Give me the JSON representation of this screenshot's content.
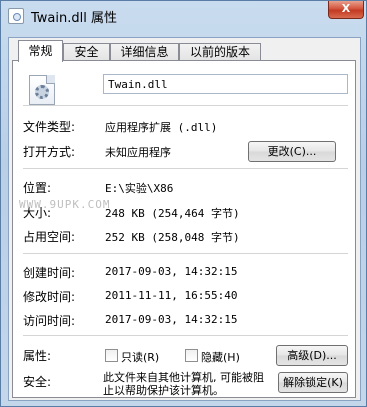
{
  "window": {
    "title": "Twain.dll 属性",
    "close_label": "X"
  },
  "tabs": [
    {
      "label": "常规",
      "active": true
    },
    {
      "label": "安全",
      "active": false
    },
    {
      "label": "详细信息",
      "active": false
    },
    {
      "label": "以前的版本",
      "active": false
    }
  ],
  "general": {
    "file_icon": "dll-gear-file-icon",
    "file_name": "Twain.dll",
    "file_type_label": "文件类型:",
    "file_type_value": "应用程序扩展 (.dll)",
    "open_with_label": "打开方式:",
    "open_with_value": "未知应用程序",
    "change_button": "更改(C)...",
    "location_label": "位置:",
    "location_value": "E:\\实验\\X86",
    "size_label": "大小:",
    "size_value": "248 KB (254,464 字节)",
    "size_on_disk_label": "占用空间:",
    "size_on_disk_value": "252 KB (258,048 字节)",
    "created_label": "创建时间:",
    "created_value": "2017-09-03, 14:32:15",
    "modified_label": "修改时间:",
    "modified_value": "2011-11-11, 16:55:40",
    "accessed_label": "访问时间:",
    "accessed_value": "2017-09-03, 14:32:15",
    "attributes_label": "属性:",
    "readonly_label": "只读(R)",
    "readonly_checked": false,
    "hidden_label": "隐藏(H)",
    "hidden_checked": false,
    "advanced_button": "高级(D)...",
    "security_label": "安全:",
    "security_text": "此文件来自其他计算机, 可能被阻止以帮助保护该计算机。",
    "unblock_button": "解除锁定(K)"
  },
  "watermark": "WWW.9UPK.COM"
}
